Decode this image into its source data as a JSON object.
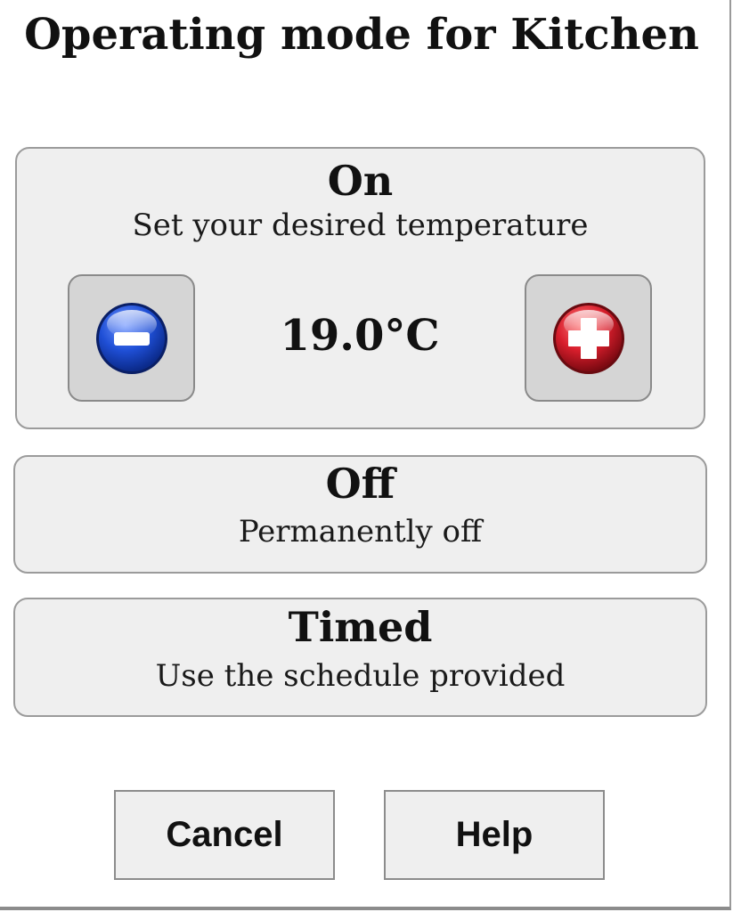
{
  "dialog": {
    "title": "Operating mode for Kitchen"
  },
  "modes": {
    "on": {
      "label": "On",
      "description": "Set your desired temperature",
      "temperature": "19.0°C",
      "decrease_icon": "minus-circle-icon",
      "increase_icon": "plus-circle-icon"
    },
    "off": {
      "label": "Off",
      "description": "Permanently off"
    },
    "timed": {
      "label": "Timed",
      "description": "Use the schedule provided"
    }
  },
  "buttons": {
    "cancel": "Cancel",
    "help": "Help"
  },
  "colors": {
    "minus_icon": "#1f4fd6",
    "plus_icon": "#d81e2c",
    "card_background": "#efefef"
  }
}
